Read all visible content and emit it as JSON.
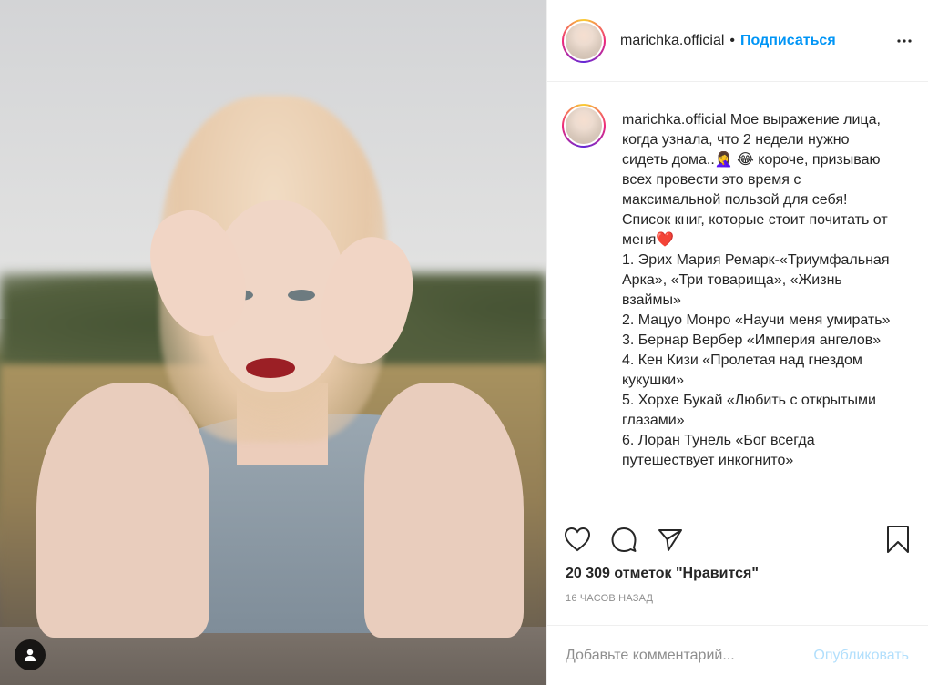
{
  "post": {
    "username": "marichka.official",
    "separator": "•",
    "follow_label": "Подписаться",
    "caption": "Мое выражение лица, когда узнала, что 2 недели нужно сидеть дома..🤦‍♀️ 😂 короче, призываю всех провести это время с максимальной пользой для себя! Список книг, которые стоит почитать от меня❤️",
    "book_list": [
      "1. Эрих Мария Ремарк-«Триумфальная Арка», «Три товарища», «Жизнь взаймы»",
      "2. Мацуо Монро «Научи меня умирать»",
      "3. Бернар Вербер «Империя ангелов»",
      "4. Кен Кизи «Пролетая над гнездом кукушки»",
      "5. Хорхе Букай «Любить с открытыми глазами»",
      "6. Лоран Тунель «Бог всегда путешествует инкогнито»"
    ],
    "likes_text": "20 309 отметок \"Нравится\"",
    "timestamp": "16 ЧАСОВ НАЗАД"
  },
  "comment": {
    "placeholder": "Добавьте комментарий...",
    "post_label": "Опубликовать"
  },
  "icons": {
    "more": "more-options-icon",
    "like": "heart-icon",
    "comment": "comment-bubble-icon",
    "share": "paper-plane-icon",
    "save": "bookmark-icon",
    "tagged_users": "user-silhouette-icon"
  },
  "colors": {
    "accent": "#0095f6",
    "muted": "#8e8e8e",
    "post_disabled": "#b2dffc"
  }
}
